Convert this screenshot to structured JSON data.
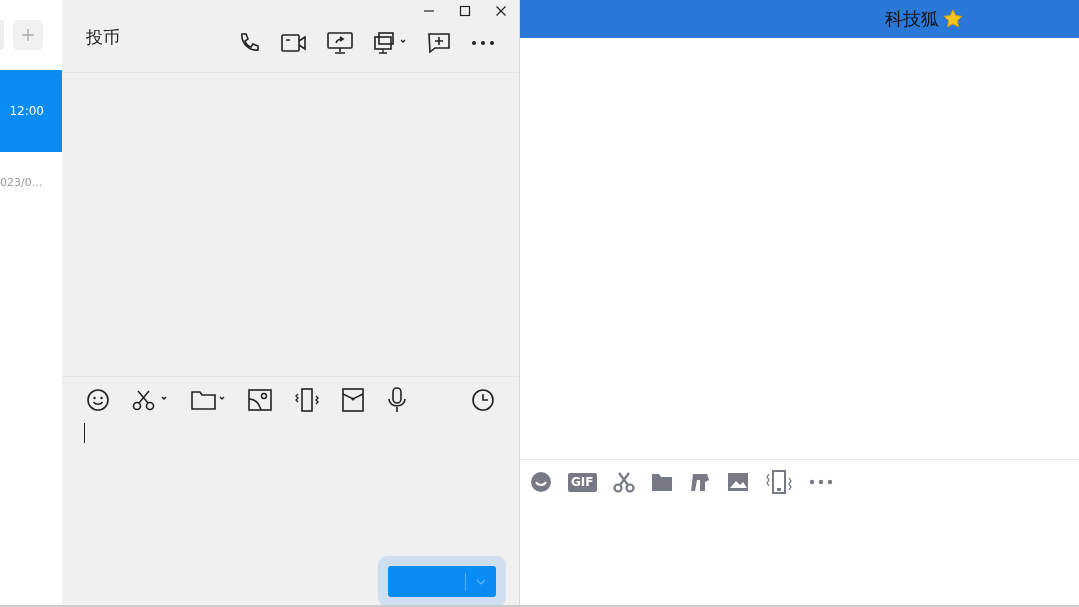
{
  "conversation_list": {
    "items": [
      {
        "time": "12:00",
        "selected": true
      },
      {
        "time": "023/0...",
        "selected": false
      }
    ]
  },
  "chat_window": {
    "title": "投币"
  },
  "background_window": {
    "title": "科技狐",
    "starred": true,
    "gif_label": "GIF"
  }
}
